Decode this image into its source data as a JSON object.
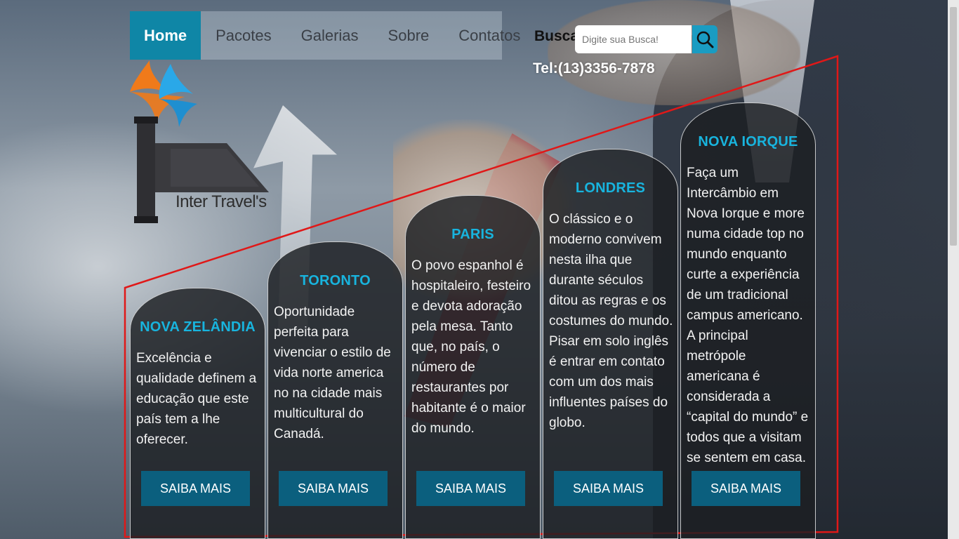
{
  "nav": {
    "items": [
      {
        "label": "Home",
        "active": true
      },
      {
        "label": "Pacotes",
        "active": false
      },
      {
        "label": "Galerias",
        "active": false
      },
      {
        "label": "Sobre",
        "active": false
      },
      {
        "label": "Contatos",
        "active": false
      }
    ]
  },
  "search": {
    "label": "Busca:",
    "placeholder": "Digite sua Busca!",
    "button_icon": "search-icon"
  },
  "phone": "Tel:(13)3356-7878",
  "logo": {
    "text": "Inter Travel's",
    "icon": "bird-wings-logo-icon"
  },
  "cards": [
    {
      "title": "NOVA ZELÂNDIA",
      "text": "Excelência e qualidade definem a educação que este país tem a lhe oferecer.",
      "button": "SAIBA MAIS"
    },
    {
      "title": "TORONTO",
      "text": "Oportunidade perfeita para vivenciar o estilo de vida norte america no na cidade mais multicultural do Canadá.",
      "button": "SAIBA MAIS"
    },
    {
      "title": "PARIS",
      "text": "O povo espanhol é hospitaleiro, festeiro e devota adoração pela mesa. Tanto que, no país, o número de restaurantes por habitante é o maior do mundo.",
      "button": "SAIBA MAIS"
    },
    {
      "title": "LONDRES",
      "text": "O clássico e o moderno convivem nesta ilha que durante séculos ditou as regras e os costumes do mundo. Pisar em solo inglês é entrar em contato com um dos mais influentes países do globo.",
      "button": "SAIBA MAIS"
    },
    {
      "title": "NOVA IORQUE",
      "text": "Faça um Intercâmbio em Nova Iorque e more numa cidade top no mundo enquanto curte a experiência de um tradicional campus americano. A principal metrópole americana é considerada a “capital do mundo” e todos que a visitam se sentem em casa.",
      "button": "SAIBA MAIS"
    }
  ],
  "colors": {
    "accent": "#0f86a6",
    "card_title": "#18b4de",
    "button": "#0b5f7e",
    "outline": "#e01818"
  }
}
